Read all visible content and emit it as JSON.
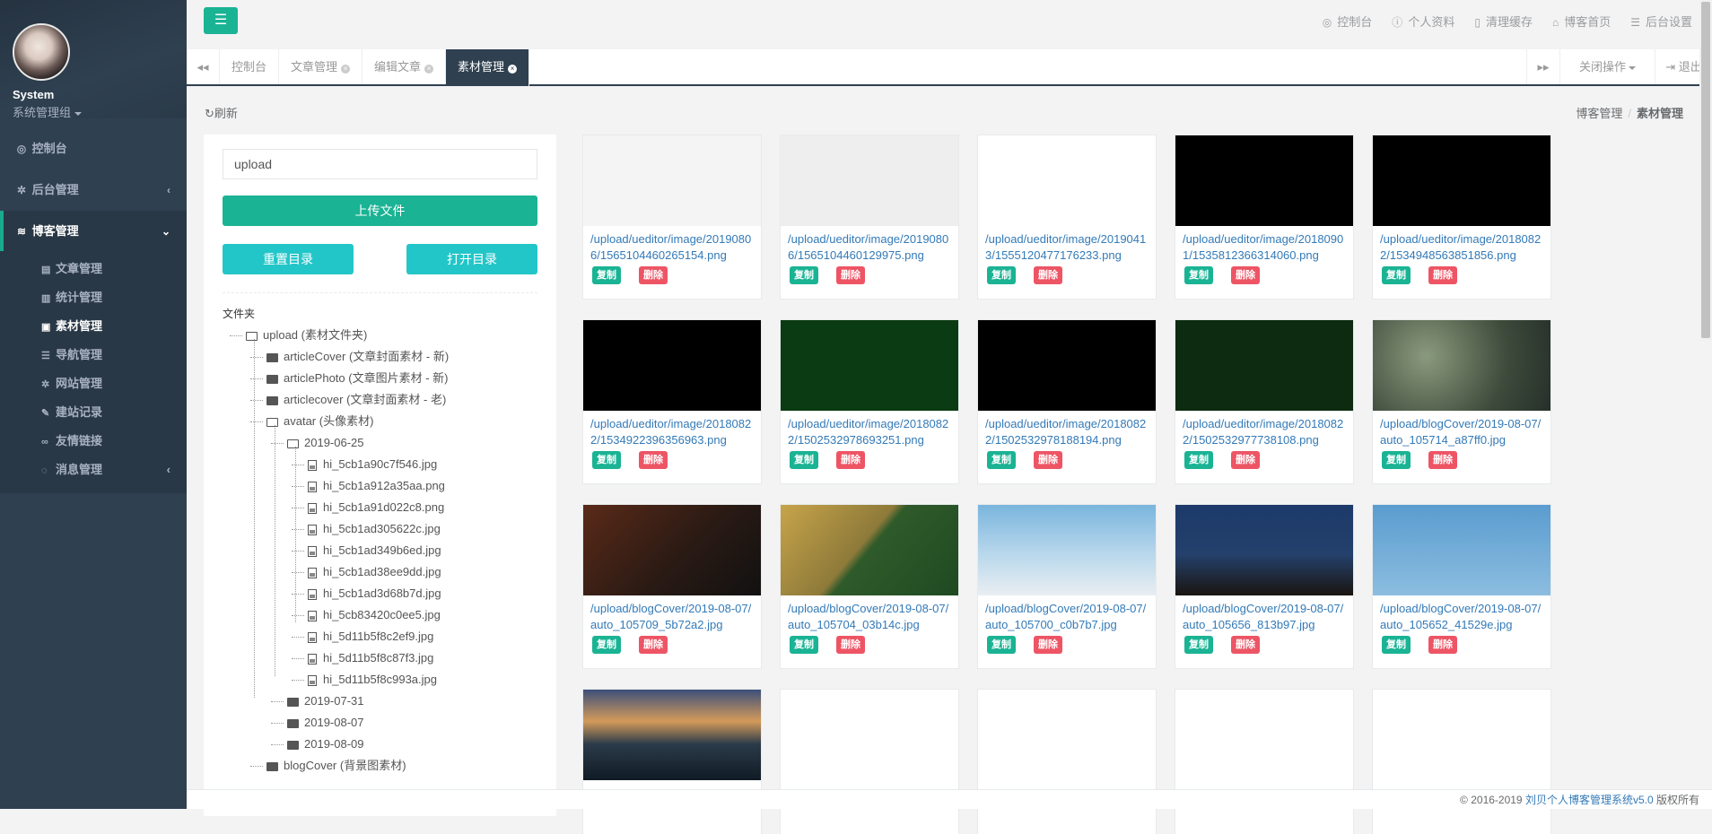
{
  "sidebar": {
    "user_name": "System",
    "user_group": "系统管理组",
    "menu": [
      {
        "label": "控制台",
        "icon": "dashboard-icon"
      },
      {
        "label": "后台管理",
        "icon": "gear-icon"
      },
      {
        "label": "博客管理",
        "icon": "rss-icon"
      }
    ],
    "submenu": [
      {
        "label": "文章管理",
        "icon": "file-text-icon"
      },
      {
        "label": "统计管理",
        "icon": "bar-chart-icon"
      },
      {
        "label": "素材管理",
        "icon": "image-icon"
      },
      {
        "label": "导航管理",
        "icon": "list-icon"
      },
      {
        "label": "网站管理",
        "icon": "gear-icon"
      },
      {
        "label": "建站记录",
        "icon": "edit-icon"
      },
      {
        "label": "友情链接",
        "icon": "link-icon"
      },
      {
        "label": "消息管理",
        "icon": "comment-icon"
      }
    ]
  },
  "topbar": {
    "links": [
      {
        "label": "控制台",
        "icon": "dashboard-icon"
      },
      {
        "label": "个人资料",
        "icon": "info-icon"
      },
      {
        "label": "清理缓存",
        "icon": "trash-icon"
      },
      {
        "label": "博客首页",
        "icon": "home-icon"
      },
      {
        "label": "后台设置",
        "icon": "list-icon"
      }
    ]
  },
  "tabs": {
    "items": [
      "控制台",
      "文章管理",
      "编辑文章",
      "素材管理"
    ],
    "close_ops": "关闭操作",
    "logout": "退出"
  },
  "content": {
    "refresh": "刷新",
    "breadcrumb": [
      "博客管理",
      "素材管理"
    ],
    "path_value": "upload",
    "upload_label": "上传文件",
    "reset_label": "重置目录",
    "open_label": "打开目录",
    "tree_title": "文件夹",
    "tree": [
      "upload (素材文件夹)",
      "articleCover (文章封面素材 - 新)",
      "articlePhoto (文章图片素材 - 新)",
      "articlecover (文章封面素材 - 老)",
      "avatar (头像素材)",
      "2019-06-25",
      "hi_5cb1a90c7f546.jpg",
      "hi_5cb1a912a35aa.png",
      "hi_5cb1a91d022c8.png",
      "hi_5cb1ad305622c.jpg",
      "hi_5cb1ad349b6ed.jpg",
      "hi_5cb1ad38ee9dd.jpg",
      "hi_5cb1ad3d68b7d.jpg",
      "hi_5cb83420c0ee5.jpg",
      "hi_5d11b5f8c2ef9.jpg",
      "hi_5d11b5f8c87f3.jpg",
      "hi_5d11b5f8c993a.jpg",
      "2019-07-31",
      "2019-08-07",
      "2019-08-09",
      "blogCover (背景图素材)"
    ],
    "copy_label": "复制",
    "delete_label": "删除",
    "images": [
      {
        "path": "/upload/ueditor/image/20190806/1565104460265154.png",
        "thumb": "login-gray"
      },
      {
        "path": "/upload/ueditor/image/20190806/1565104460129975.png",
        "thumb": "login-form"
      },
      {
        "path": "/upload/ueditor/image/20190413/1555120477176233.png",
        "thumb": "pagination"
      },
      {
        "path": "/upload/ueditor/image/20180901/1535812366314060.png",
        "thumb": "terminal-green"
      },
      {
        "path": "/upload/ueditor/image/20180822/1534948563851856.png",
        "thumb": "terminal"
      },
      {
        "path": "/upload/ueditor/image/20180822/1534922396356963.png",
        "thumb": "terminal"
      },
      {
        "path": "/upload/ueditor/image/20180822/1502532978693251.png",
        "thumb": "green-red"
      },
      {
        "path": "/upload/ueditor/image/20180822/1502532978188194.png",
        "thumb": "black"
      },
      {
        "path": "/upload/ueditor/image/20180822/1502532977738108.png",
        "thumb": "browser"
      },
      {
        "path": "/upload/blogCover/2019-08-07/auto_105714_a87ff0.jpg",
        "thumb": "flowers"
      },
      {
        "path": "/upload/blogCover/2019-08-07/auto_105709_5b72a2.jpg",
        "thumb": "tunnel"
      },
      {
        "path": "/upload/blogCover/2019-08-07/auto_105704_03b14c.jpg",
        "thumb": "forest"
      },
      {
        "path": "/upload/blogCover/2019-08-07/auto_105700_c0b7b7.jpg",
        "thumb": "blossom"
      },
      {
        "path": "/upload/blogCover/2019-08-07/auto_105656_813b97.jpg",
        "thumb": "castle"
      },
      {
        "path": "/upload/blogCover/2019-08-07/auto_105652_41529e.jpg",
        "thumb": "ferris"
      },
      {
        "path": "",
        "thumb": "lake"
      },
      {
        "path": "",
        "thumb": "empty"
      },
      {
        "path": "",
        "thumb": "empty"
      },
      {
        "path": "",
        "thumb": "empty"
      },
      {
        "path": "",
        "thumb": "empty"
      }
    ]
  },
  "footer": {
    "prefix": "© 2016-2019",
    "link": "刘贝个人博客管理系统v5.0",
    "suffix": "版权所有"
  },
  "colors": {
    "primary": "#1ab394",
    "info": "#23c6c8",
    "danger": "#ed5565",
    "sidebar": "#2f4050"
  }
}
